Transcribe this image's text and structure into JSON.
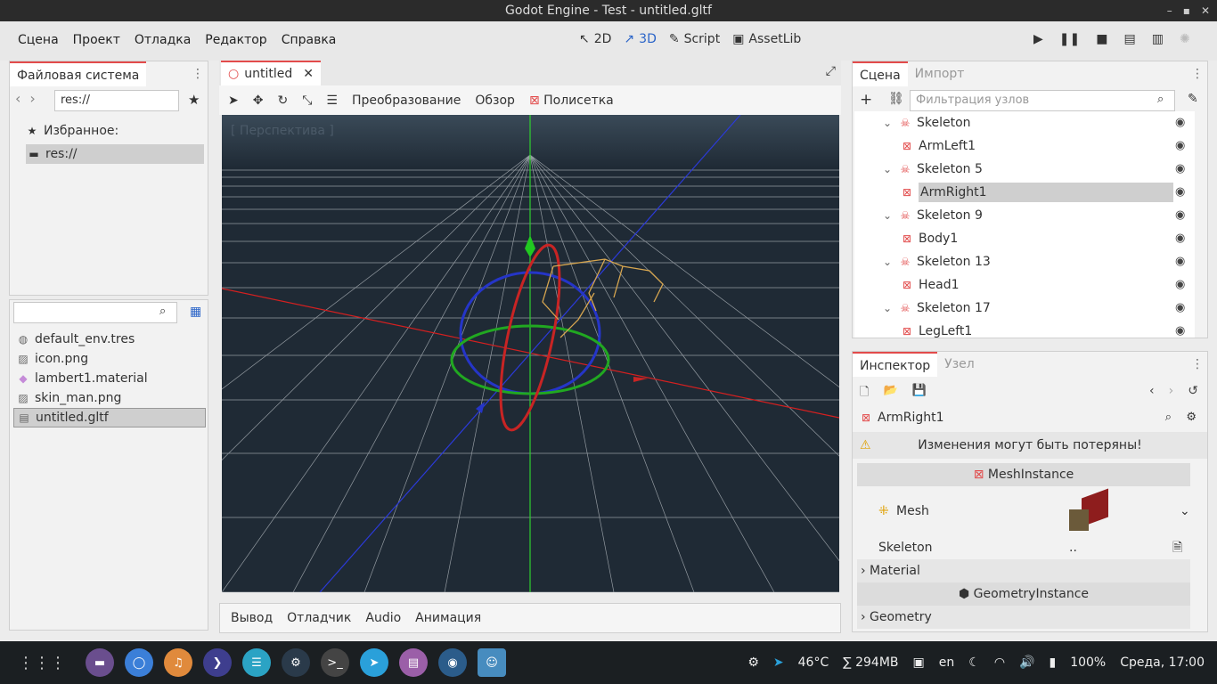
{
  "window": {
    "title": "Godot Engine - Test - untitled.gltf",
    "controls": [
      "–",
      "▪",
      "✕"
    ]
  },
  "menu": [
    "Сцена",
    "Проект",
    "Отладка",
    "Редактор",
    "Справка"
  ],
  "modes": [
    {
      "icon": "2d-icon",
      "label": "2D"
    },
    {
      "icon": "3d-icon",
      "label": "3D"
    },
    {
      "icon": "script-icon",
      "label": "Script"
    },
    {
      "icon": "assetlib-icon",
      "label": "AssetLib"
    }
  ],
  "filesystem": {
    "tab": "Файловая система",
    "path": "res://",
    "favorites_label": "Избранное:",
    "favorite_item": "res://",
    "search_placeholder": "",
    "files": [
      {
        "icon": "globe-icon",
        "name": "default_env.tres"
      },
      {
        "icon": "image-icon",
        "name": "icon.png"
      },
      {
        "icon": "material-icon",
        "name": "lambert1.material"
      },
      {
        "icon": "image-icon",
        "name": "skin_man.png"
      },
      {
        "icon": "scene-icon",
        "name": "untitled.gltf"
      }
    ]
  },
  "editor": {
    "tab": "untitled",
    "toolbar": {
      "transform": "Преобразование",
      "view": "Обзор",
      "grid": "Полисетка"
    },
    "viewport_label": "[ Перспектива ]"
  },
  "bottom_tabs": [
    "Вывод",
    "Отладчик",
    "Audio",
    "Анимация"
  ],
  "scene": {
    "tabs": [
      "Сцена",
      "Импорт"
    ],
    "filter_placeholder": "Фильтрация узлов",
    "nodes": [
      {
        "name": "Skeleton",
        "type": "skeleton",
        "indent": 1
      },
      {
        "name": "ArmLeft1",
        "type": "mesh",
        "indent": 2
      },
      {
        "name": "Skeleton 5",
        "type": "skeleton",
        "indent": 1
      },
      {
        "name": "ArmRight1",
        "type": "mesh",
        "indent": 2
      },
      {
        "name": "Skeleton 9",
        "type": "skeleton",
        "indent": 1
      },
      {
        "name": "Body1",
        "type": "mesh",
        "indent": 2
      },
      {
        "name": "Skeleton 13",
        "type": "skeleton",
        "indent": 1
      },
      {
        "name": "Head1",
        "type": "mesh",
        "indent": 2
      },
      {
        "name": "Skeleton 17",
        "type": "skeleton",
        "indent": 1
      },
      {
        "name": "LegLeft1",
        "type": "mesh",
        "indent": 2
      }
    ]
  },
  "inspector": {
    "tabs": [
      "Инспектор",
      "Узел"
    ],
    "object": "ArmRight1",
    "warning": "Изменения могут быть потеряны!",
    "section1": "MeshInstance",
    "mesh_label": "Mesh",
    "skeleton_label": "Skeleton",
    "skeleton_value": "..",
    "material_label": "Material",
    "section2": "GeometryInstance",
    "geometry_label": "Geometry"
  },
  "taskbar": {
    "temp": "46°C",
    "memory": "∑ 294MB",
    "lang": "en",
    "volume": "100%",
    "clock": "Среда, 17:00"
  }
}
